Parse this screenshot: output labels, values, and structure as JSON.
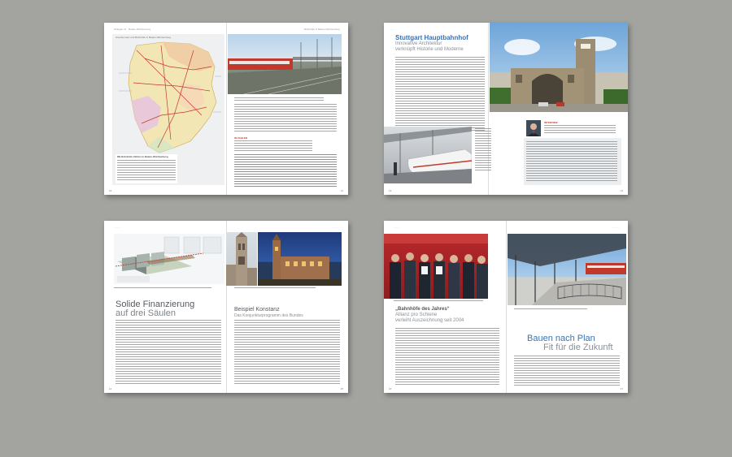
{
  "spreads": [
    {
      "id": "map-spread",
      "header_left": "Stuttgart 21 · Baden-Württemberg",
      "header_right": "Bahnhöfe in Baden-Württemberg",
      "map_title": "Streckennetz und Bahnhöfe in Baden-Württemberg",
      "table_title": "DB Bahnhöfe Zahlen in Baden-Württemberg",
      "red_label": "IN ZAHLEN",
      "page_left": "10",
      "page_right": "11"
    },
    {
      "id": "stuttgart-spread",
      "title": "Stuttgart Hauptbahnhof",
      "subtitle_1": "Innovative Architektur",
      "subtitle_2": "verknüpft Historie und Moderne",
      "red_label": "INTERVIEW",
      "page_left": "12",
      "page_right": "13"
    },
    {
      "id": "finance-spread",
      "title_1": "Solide Finanzierung",
      "title_2": "auf drei Säulen",
      "right_title": "Beispiel Konstanz",
      "right_subtitle": "Das Konjunkturprogramm des Bundes",
      "page_left": "14",
      "page_right": "15"
    },
    {
      "id": "award-spread",
      "quote_1": "„Bahnhöfe des Jahres“",
      "quote_2": "Allianz pro Schiene",
      "quote_3": "verleiht Auszeichnung seit 2004",
      "title_1": "Bauen nach Plan",
      "title_2": "Fit für die Zukunft",
      "page_left": "16",
      "page_right": "17"
    }
  ]
}
